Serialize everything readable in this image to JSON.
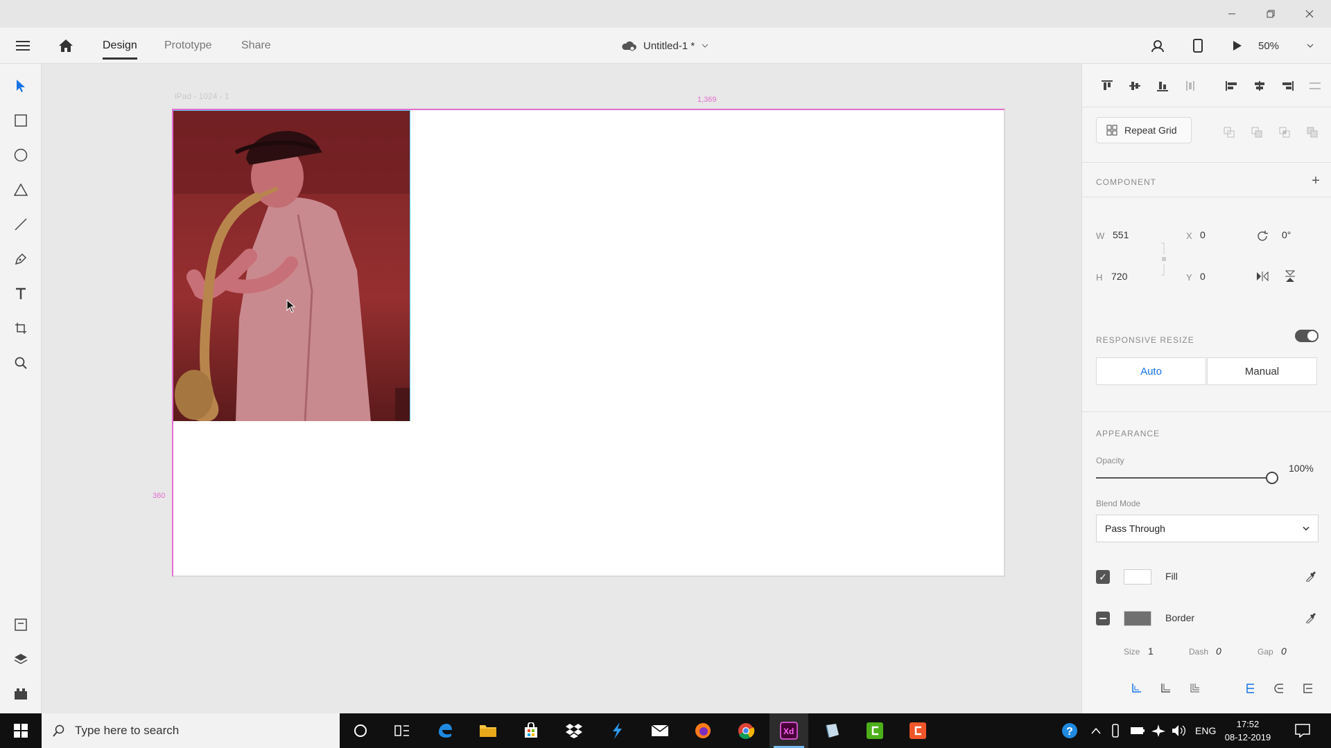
{
  "app": {
    "tabs": [
      {
        "label": "Design",
        "active": true
      },
      {
        "label": "Prototype",
        "active": false
      },
      {
        "label": "Share",
        "active": false
      }
    ],
    "doc_title": "Untitled-1 *",
    "zoom": "50%"
  },
  "canvas": {
    "artboard_label": "iPad - 1024 - 1",
    "guide_top": "1,369",
    "guide_left": "360"
  },
  "panel": {
    "repeat_grid": "Repeat Grid",
    "component_title": "COMPONENT",
    "w_label": "W",
    "w_value": "551",
    "h_label": "H",
    "h_value": "720",
    "x_label": "X",
    "x_value": "0",
    "y_label": "Y",
    "y_value": "0",
    "rotation": "0°",
    "responsive_title": "RESPONSIVE RESIZE",
    "responsive_on": true,
    "auto_label": "Auto",
    "manual_label": "Manual",
    "appearance_title": "APPEARANCE",
    "opacity_label": "Opacity",
    "opacity_value": "100%",
    "opacity_level": 1.0,
    "blend_label": "Blend Mode",
    "blend_value": "Pass Through",
    "fill_label": "Fill",
    "fill_color": "#ffffff",
    "border_label": "Border",
    "border_color": "#707070",
    "size_label": "Size",
    "size_value": "1",
    "dash_label": "Dash",
    "dash_value": "0",
    "gap_label": "Gap",
    "gap_value": "0"
  },
  "taskbar": {
    "search_placeholder": "Type here to search",
    "lang": "ENG",
    "time": "17:52",
    "date": "08-12-2019"
  },
  "colors": {
    "accent": "#1473e6",
    "guide": "#e36cd0",
    "selection": "#59c8f0"
  }
}
